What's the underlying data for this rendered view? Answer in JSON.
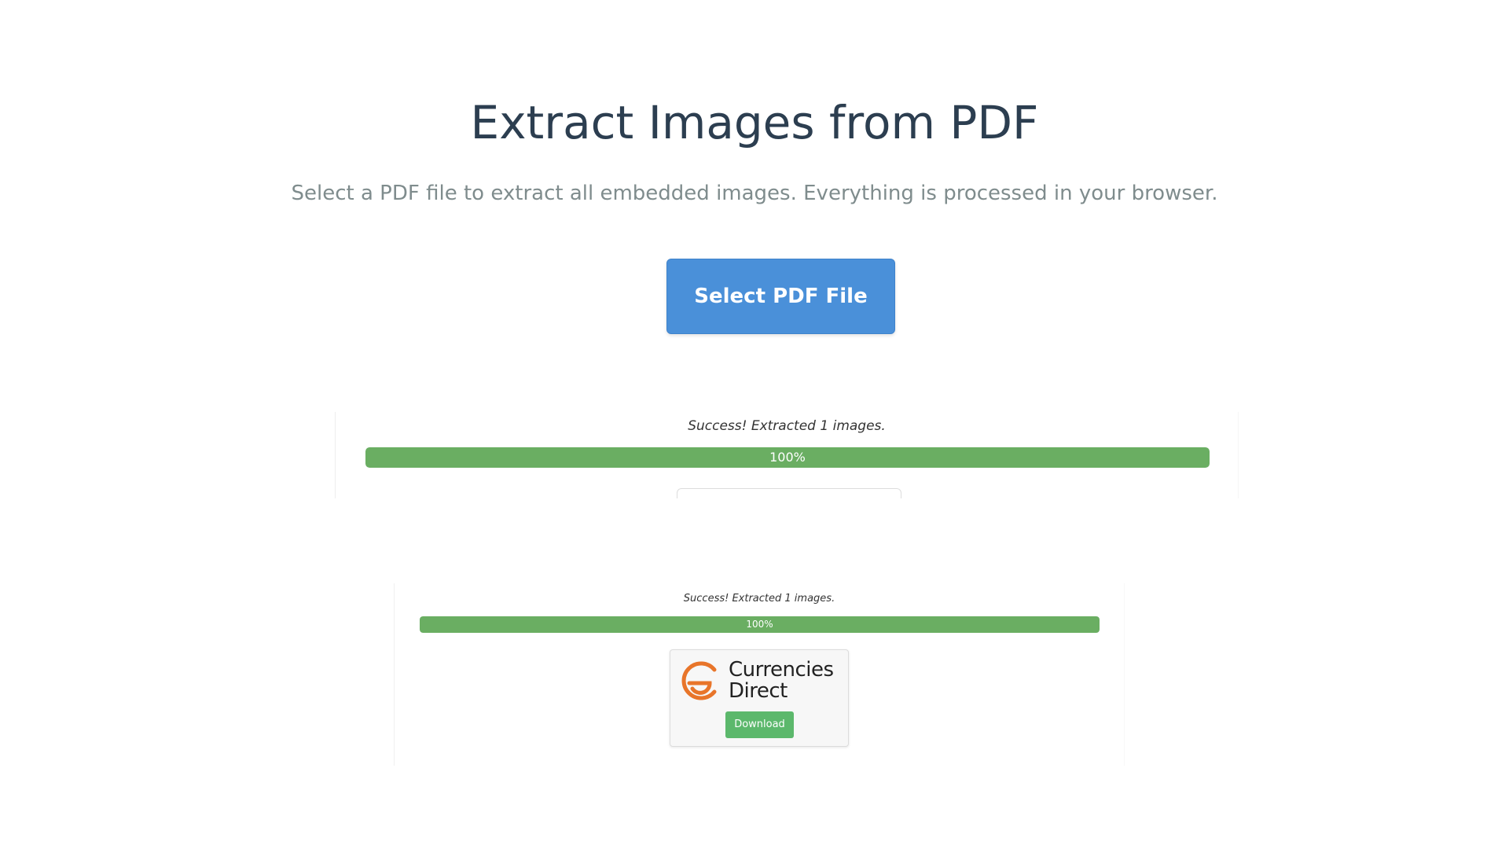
{
  "header": {
    "title": "Extract Images from PDF",
    "subtitle": "Select a PDF file to extract all embedded images. Everything is processed in your browser."
  },
  "select_button": {
    "label": "Select PDF File"
  },
  "result_panel_top": {
    "status": "Success! Extracted 1 images.",
    "progress_label": "100%",
    "progress_fraction": 1.0
  },
  "result_panel_bottom": {
    "status": "Success! Extracted 1 images.",
    "progress_label": "100%",
    "progress_fraction": 1.0,
    "image_card": {
      "logo_line1": "Currencies",
      "logo_line2": "Direct",
      "download_label": "Download"
    }
  },
  "colors": {
    "title": "#2c3e50",
    "subtitle": "#7f8c8d",
    "primary_button": "#4a90d9",
    "progress_fill": "#6aae62",
    "download_button": "#5cb86c",
    "logo_orange": "#e8752a"
  }
}
